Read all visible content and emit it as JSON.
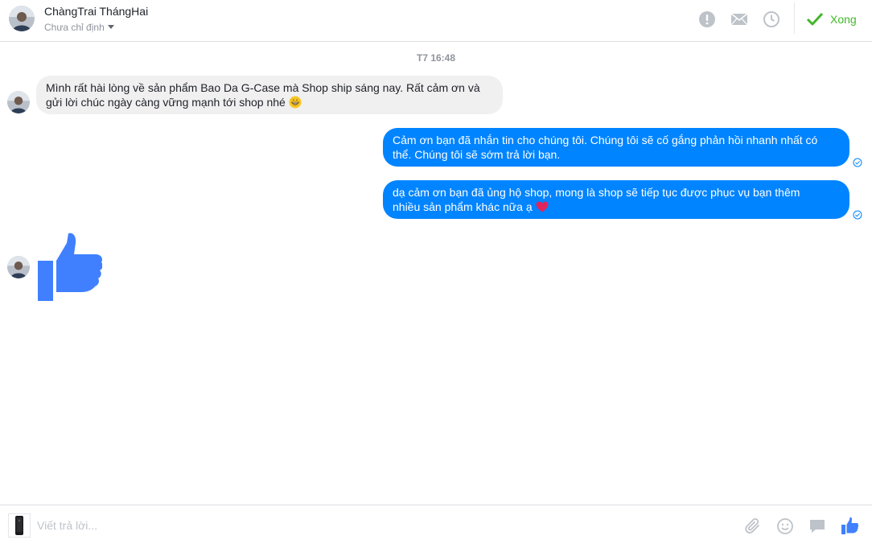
{
  "header": {
    "contact_name": "ChàngTrai ThángHai",
    "assign_label": "Chưa chỉ định",
    "done_label": "Xong",
    "icons": [
      "alert-icon",
      "mail-icon",
      "clock-icon",
      "check-icon"
    ]
  },
  "conversation": {
    "timestamp": "T7 16:48",
    "incoming_message": {
      "text": "Mình rất hài lòng về sản phẩm Bao Da G-Case mà Shop ship sáng nay. Rất cảm ơn và gửi lời chúc ngày càng vững mạnh tới shop nhé",
      "line1": "Mình rất hài lòng về sản phẩm Bao Da G-Case mà Shop ship sáng nay. Rất cảm ơn và",
      "line2": "gửi lời chúc ngày càng vững mạnh tới shop nhé",
      "emoji": "grinning-face"
    },
    "outgoing_messages": [
      {
        "line1": "Cảm ơn bạn đã nhắn tin cho chúng tôi. Chúng tôi sẽ cố gắng phản hồi nhanh nhất có",
        "line2": "thể. Chúng tôi sẽ sớm trả lời bạn.",
        "status": "sent"
      },
      {
        "line1": "dạ cảm ơn bạn đã ủng hộ shop, mong là shop sẽ tiếp tục được phục vụ bạn thêm",
        "line2": "nhiều sản phẩm khác nữa ạ",
        "emoji": "red-heart",
        "status": "sent"
      }
    ],
    "incoming_sticker": "thumbs-up"
  },
  "composer": {
    "placeholder": "Viết trả lời...",
    "value": "",
    "icons": [
      "attachment-icon",
      "emoji-icon",
      "saved-reply-icon",
      "like-icon"
    ]
  },
  "colors": {
    "accent_blue": "#0084ff",
    "like_blue": "#4080ff",
    "done_green": "#42b72a",
    "incoming_bubble": "#f1f0f0"
  }
}
